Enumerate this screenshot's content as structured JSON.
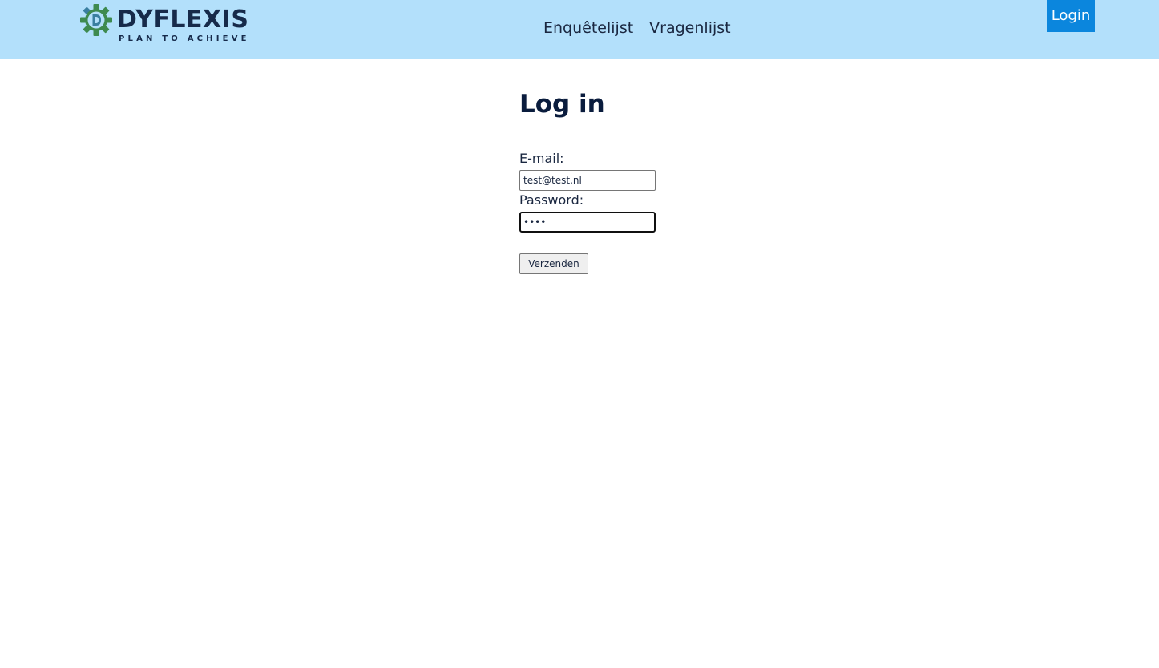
{
  "header": {
    "logo": {
      "wordmark": "DYFLEXIS",
      "tagline": "PLAN TO ACHIEVE",
      "icon": "gear-d-logo-icon"
    },
    "nav": [
      {
        "label": "Enquêtelijst"
      },
      {
        "label": "Vragenlijst"
      }
    ],
    "login_label": "Login"
  },
  "main": {
    "title": "Log in",
    "email": {
      "label": "E-mail:",
      "value": "test@test.nl"
    },
    "password": {
      "label": "Password:",
      "value": "••••"
    },
    "submit_label": "Verzenden"
  },
  "colors": {
    "header_bg": "#b3e0fb",
    "login_bg": "#0b86dd",
    "logo_green": "#3e8a4f",
    "logo_navy": "#162a4a",
    "logo_teal": "#3a7fa0"
  }
}
